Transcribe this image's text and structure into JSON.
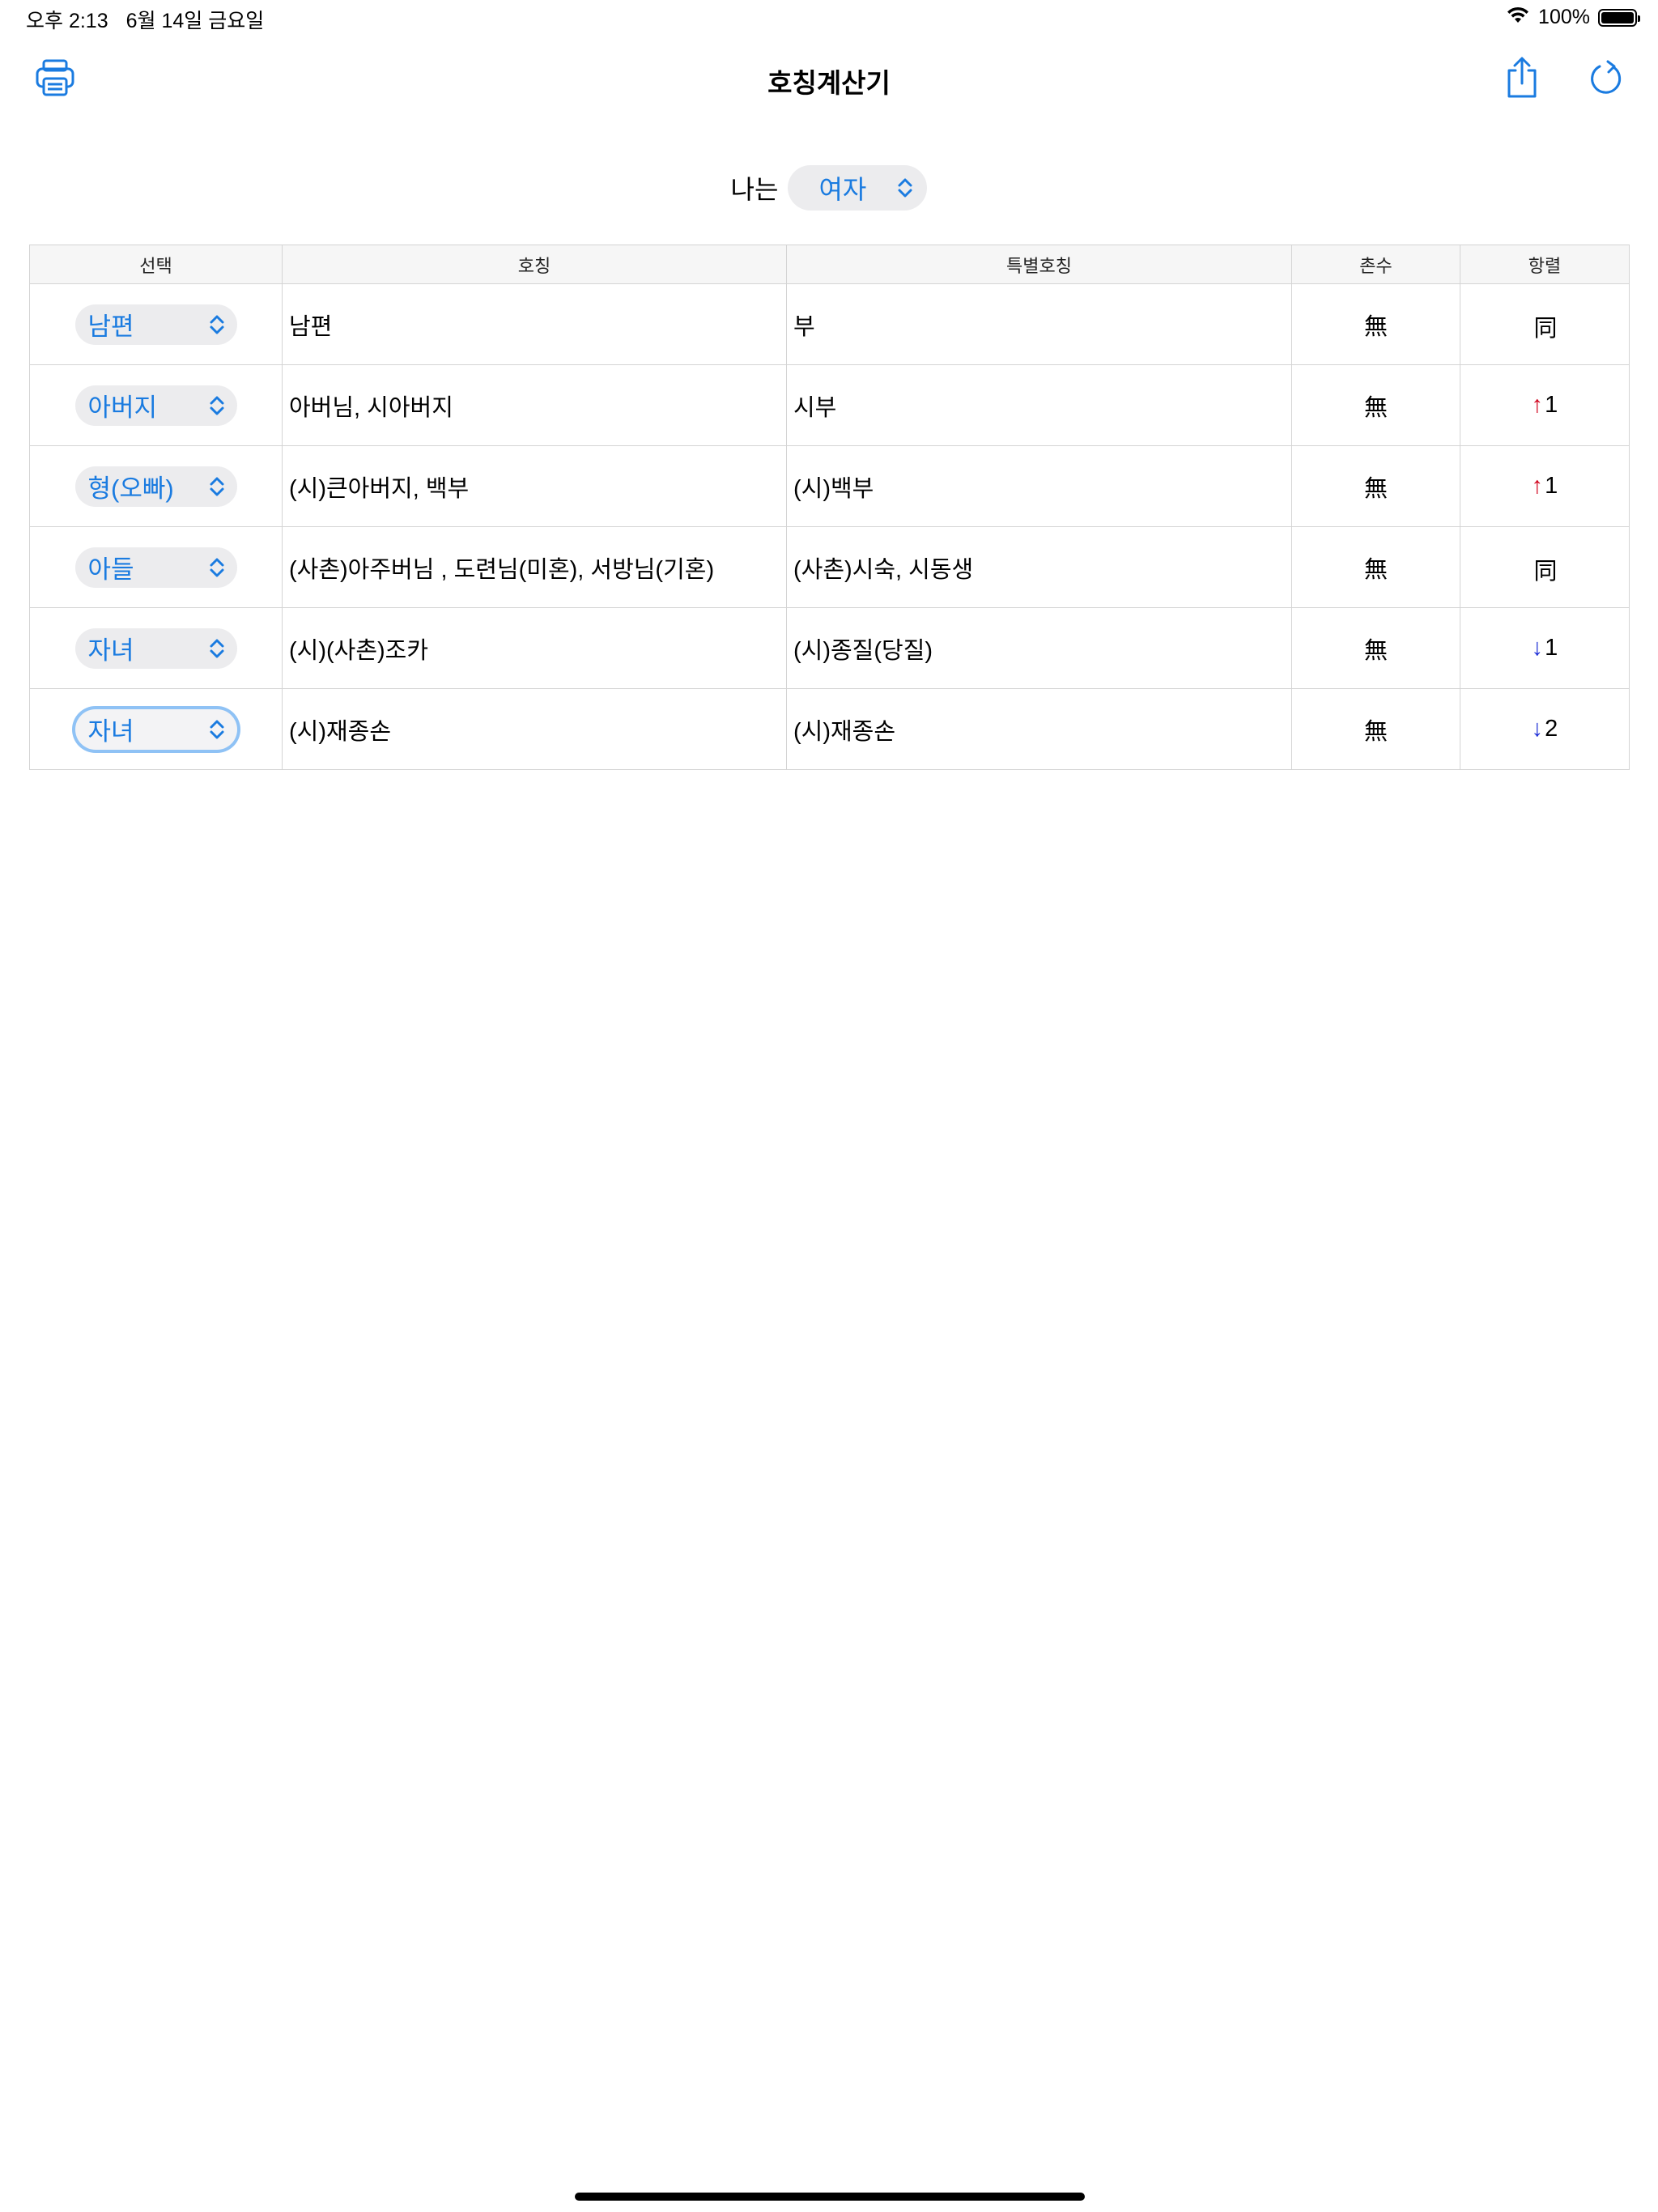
{
  "status_bar": {
    "time": "오후 2:13",
    "date": "6월 14일 금요일",
    "battery": "100%"
  },
  "nav": {
    "title": "호칭계산기",
    "left_icon": "printer-icon",
    "right_icons": [
      "share-icon",
      "refresh-icon"
    ],
    "accent_color": "#1a7be0"
  },
  "gender": {
    "label": "나는",
    "value": "여자"
  },
  "table": {
    "headers": [
      "선택",
      "호칭",
      "특별호칭",
      "촌수",
      "항렬"
    ],
    "rows": [
      {
        "select": "남편",
        "title": "남편",
        "special": "부",
        "chonsu": "無",
        "hangryeol": {
          "dir": "same",
          "arrow": "",
          "value": "同"
        }
      },
      {
        "select": "아버지",
        "title": "아버님, 시아버지",
        "special": "시부",
        "chonsu": "無",
        "hangryeol": {
          "dir": "up",
          "arrow": "↑",
          "value": "1"
        }
      },
      {
        "select": "형(오빠)",
        "title": "(시)큰아버지, 백부",
        "special": "(시)백부",
        "chonsu": "無",
        "hangryeol": {
          "dir": "up",
          "arrow": "↑",
          "value": "1"
        }
      },
      {
        "select": "아들",
        "title": "(사촌)아주버님 , 도련님(미혼), 서방님(기혼)",
        "special": "(사촌)시숙, 시동생",
        "chonsu": "無",
        "hangryeol": {
          "dir": "same",
          "arrow": "",
          "value": "同"
        }
      },
      {
        "select": "자녀",
        "title": "(시)(사촌)조카",
        "special": "(시)종질(당질)",
        "chonsu": "無",
        "hangryeol": {
          "dir": "down",
          "arrow": "↓",
          "value": "1"
        }
      },
      {
        "select": "자녀",
        "title": "(시)재종손",
        "special": "(시)재종손",
        "chonsu": "無",
        "hangryeol": {
          "dir": "down",
          "arrow": "↓",
          "value": "2"
        },
        "focused": true
      }
    ]
  }
}
